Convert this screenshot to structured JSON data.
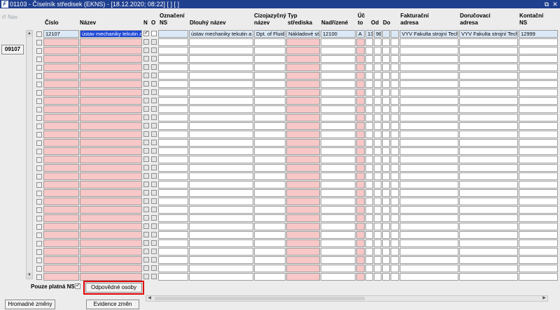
{
  "window": {
    "title": "01103 - Číselník středisek (EKNS) - [18.12.2020; 08:22]  [ ]  [ ]",
    "icon": "app-icon",
    "controls": [
      "restore-icon",
      "close-icon"
    ]
  },
  "left_panel": {
    "nav_label": "Nav",
    "nav_button": "09107"
  },
  "columns": {
    "cislo": "Číslo",
    "nazev": "Název",
    "n": "N",
    "o": "O",
    "oznaceni_1": "Označení",
    "oznaceni_2": "NS",
    "dlouhy": "Dlouhý název",
    "cizo_1": "Cizojazyčný",
    "cizo_2": "název",
    "typ_1": "Typ",
    "typ_2": "střediska",
    "nadrizene": "Nadřízené",
    "ucto_1": "Úč",
    "ucto_2": "to",
    "od": "Od",
    "do": "Do",
    "fakt_1": "Fakturační",
    "fakt_2": "adresa",
    "dor_1": "Doručovací",
    "dor_2": "adresa",
    "kont_1": "Kontační",
    "kont_2": "NS"
  },
  "first_row": {
    "cislo": "12107",
    "nazev": "ústav mechaniky tekutin a",
    "n_checked": true,
    "o_checked": false,
    "oznaceni": "",
    "dlouhy": "ústav mechaniky tekutin a e",
    "cizo": "Dpt. of Fluid",
    "typ": "Nákladové stř",
    "nadrizene": "12100",
    "ucto": "A",
    "od": "13",
    "od2": "98",
    "fakt": "VYV Fakulta strojní Tech",
    "dor": "VYV Fakulta strojní Tech",
    "kont": "12999"
  },
  "empty_rows": 29,
  "bottom": {
    "pouze_label": "Pouze platná NS",
    "pouze_checked": true,
    "odpovedne_button": "Odpovědné osoby",
    "hromadne_button": "Hromadné změny",
    "evidence_button": "Evidence změn"
  },
  "colors": {
    "titlebar": "#1f3f8f",
    "required_field": "#f8c7c7",
    "current_row": "#dbe9f7",
    "selection": "#1c46d8",
    "highlight_border": "#e00000"
  }
}
